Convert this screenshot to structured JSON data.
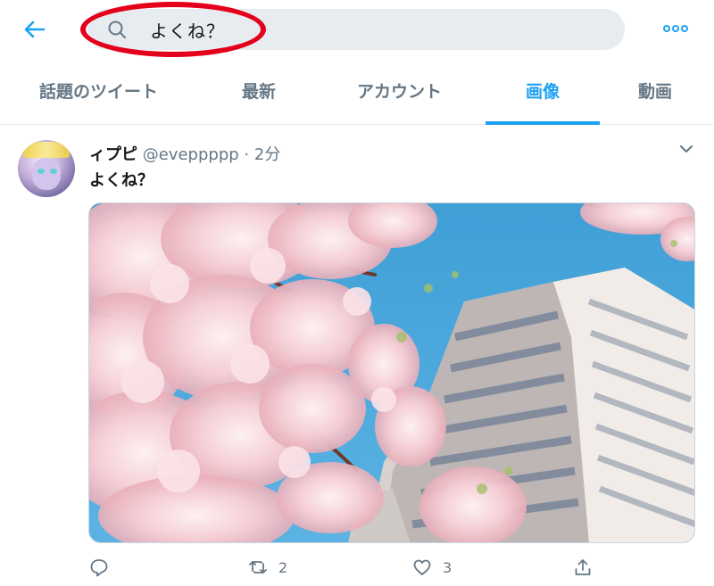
{
  "header": {
    "search_query": "よくね？",
    "highlight_color": "#e4001b"
  },
  "tabs": [
    {
      "label": "話題のツイート",
      "active": false
    },
    {
      "label": "最新",
      "active": false
    },
    {
      "label": "アカウント",
      "active": false
    },
    {
      "label": "画像",
      "active": true
    },
    {
      "label": "動画",
      "active": false
    }
  ],
  "tweet": {
    "display_name": "ィプピ",
    "handle": "@eveppppp",
    "separator": "·",
    "time": "2分",
    "text": "よくね？",
    "photo_description_icon": "cherry-blossom-building-photo",
    "actions": {
      "reply_count": "",
      "retweet_count": "2",
      "like_count": "3"
    }
  },
  "colors": {
    "accent": "#1da1f2",
    "muted": "#657786",
    "search_bg": "#e6ecf0"
  }
}
